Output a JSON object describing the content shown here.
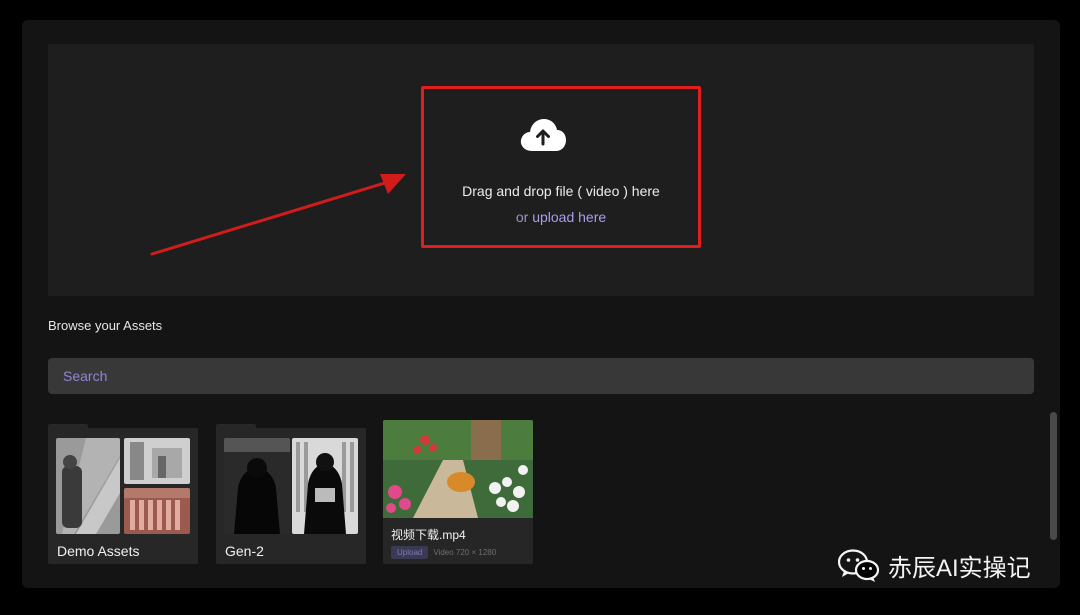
{
  "upload": {
    "title": "Drag and drop file ( video ) here",
    "or_text": "or",
    "link_text": "upload here"
  },
  "assets": {
    "section_title": "Browse your Assets",
    "search_placeholder": "Search",
    "folders": [
      {
        "name": "Demo Assets"
      },
      {
        "name": "Gen-2"
      }
    ],
    "files": [
      {
        "name": "视频下载.mp4",
        "badge": "Upload",
        "meta": "Video 720 × 1280"
      }
    ]
  },
  "watermark": {
    "text": "赤辰AI实操记",
    "icon": "wechat-icon"
  },
  "colors": {
    "highlight": "#e21d1d",
    "accent_link": "#a79df0",
    "placeholder": "#8f86d6"
  }
}
